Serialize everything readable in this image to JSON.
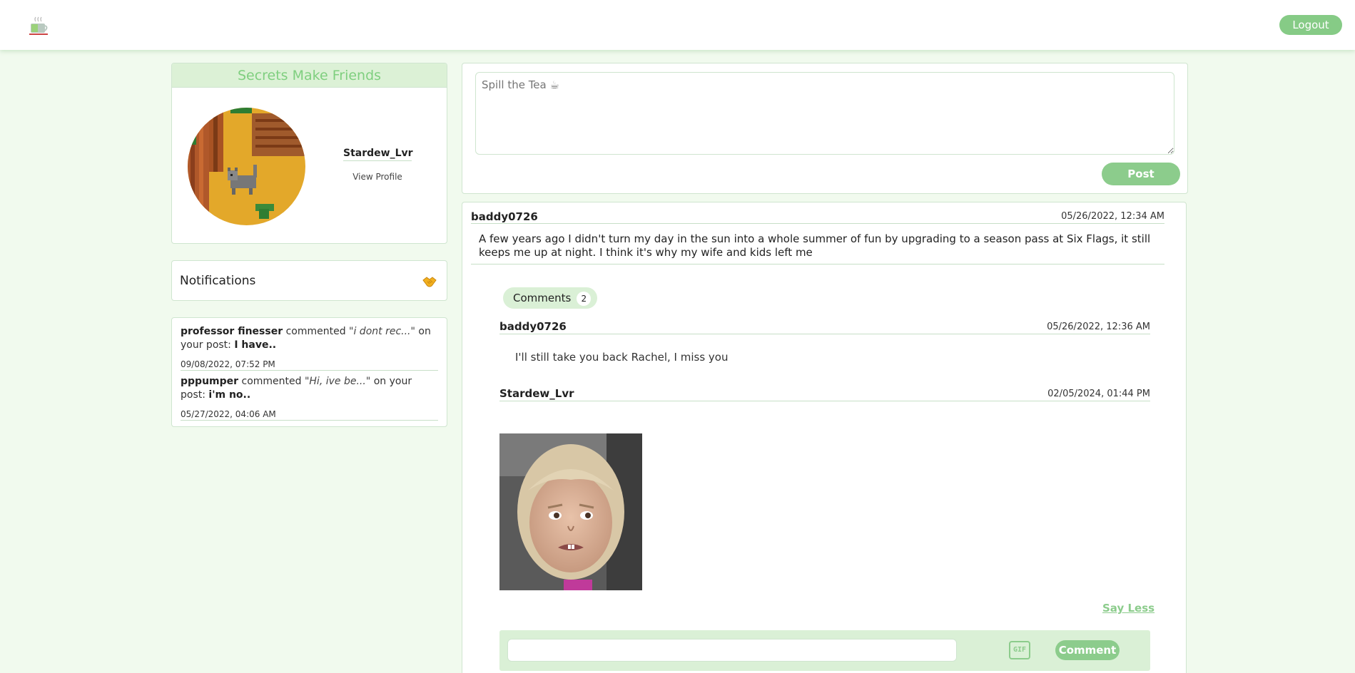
{
  "header": {
    "logo_icon": "teacup-icon",
    "logout_label": "Logout"
  },
  "profile": {
    "title": "Secrets Make Friends",
    "username": "Stardew_Lvr",
    "view_profile_label": "View Profile",
    "avatar_icon": "pixel-cat-avatar"
  },
  "notifications": {
    "title": "Notifications",
    "icon": "handshake-icon",
    "items": [
      {
        "user": "professor finesser",
        "verb": "commented",
        "quote": "\"i dont rec...\"",
        "mid": "on your post:",
        "post": "I have..",
        "time": "09/08/2022, 07:52 PM"
      },
      {
        "user": "pppumper",
        "verb": "commented",
        "quote": "\"Hi, ive be...\"",
        "mid": "on your post:",
        "post": "i'm no..",
        "time": "05/27/2022, 04:06 AM"
      }
    ]
  },
  "composer": {
    "placeholder": "Spill the Tea ☕",
    "post_label": "Post"
  },
  "post": {
    "author": "baddy0726",
    "date": "05/26/2022, 12:34 AM",
    "body": "A few years ago I didn't turn my day in the sun into a whole summer of fun by upgrading to a season pass at Six Flags, it still keeps me up at night. I think it's why my wife and kids left me",
    "comments_label": "Comments",
    "comments_count": "2",
    "comments": [
      {
        "author": "baddy0726",
        "date": "05/26/2022, 12:36 AM",
        "text": "I'll still take you back Rachel, I miss you"
      },
      {
        "author": "Stardew_Lvr",
        "date": "02/05/2024, 01:44 PM",
        "gif_icon": "side-eye-girl-gif"
      }
    ],
    "say_less_label": "Say Less",
    "comment_input_placeholder": "",
    "gif_label": "GIF",
    "comment_button_label": "Comment"
  },
  "colors": {
    "accent": "#8ccc8c",
    "page_bg": "#f1faee",
    "header_bg": "#dcf1d6"
  }
}
